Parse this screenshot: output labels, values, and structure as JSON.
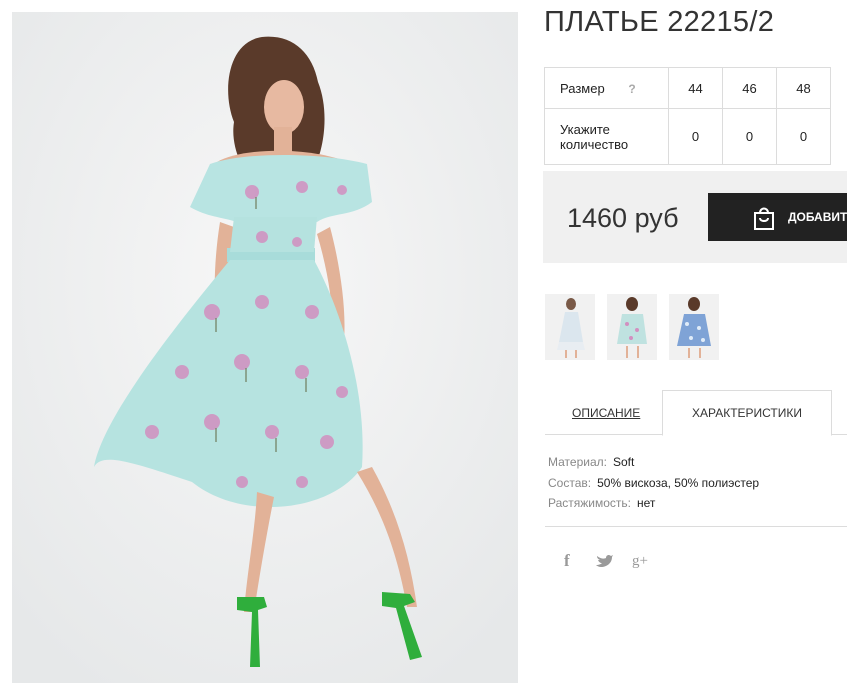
{
  "product": {
    "title": "ПЛАТЬЕ 22215/2",
    "image_name": "main-product-photo"
  },
  "sizes": {
    "size_label": "Размер",
    "help_icon": "question-icon",
    "help_text": "?",
    "qty_label": "Укажите количество",
    "columns": [
      "44",
      "46",
      "48"
    ],
    "quantities": [
      "0",
      "0",
      "0"
    ]
  },
  "purchase": {
    "price": "1460 руб",
    "add_label": "ДОБАВИТ",
    "add_icon": "shopping-bag-icon",
    "button_color": "#222222",
    "box_color": "#f0f0f0"
  },
  "thumbnails": [
    "thumbnail-1",
    "thumbnail-2",
    "thumbnail-3"
  ],
  "tabs": [
    {
      "label": "ОПИСАНИЕ",
      "active": false
    },
    {
      "label": "ХАРАКТЕРИСТИКИ",
      "active": true
    }
  ],
  "properties": [
    {
      "key": "Материал:",
      "value": "Soft"
    },
    {
      "key": "Состав:",
      "value": "50% вискоза, 50% полиэстер"
    },
    {
      "key": "Растяжимость:",
      "value": "нет"
    }
  ],
  "social": [
    {
      "name": "facebook-icon",
      "glyph": "f"
    },
    {
      "name": "twitter-icon"
    },
    {
      "name": "google-plus-icon",
      "glyph": "g+"
    }
  ]
}
